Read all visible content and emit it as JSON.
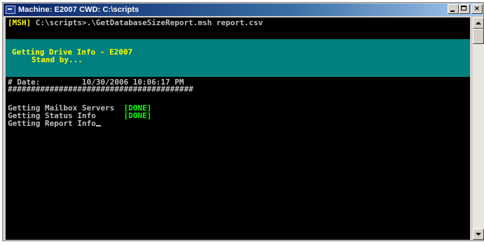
{
  "window": {
    "title": "Machine: E2007 CWD: C:\\scripts",
    "controls": {
      "minimize_label": "",
      "maximize_label": "",
      "close_label": "×"
    }
  },
  "console": {
    "prompt": {
      "tag": "[MSH]",
      "command": " C:\\scripts>.\\GetDatabaseSizeReport.msh report.csv"
    },
    "banner": {
      "line1": "Getting Drive Info - E2007",
      "line2": "Stand by..."
    },
    "date_line": "# Date:         10/30/2006 10:06:17 PM",
    "separator": "########################################",
    "tasks": [
      {
        "label": "Getting Mailbox Servers  ",
        "status": "[DONE]"
      },
      {
        "label": "Getting Status Info      ",
        "status": "[DONE]"
      },
      {
        "label": "Getting Report Info",
        "status": ""
      }
    ]
  },
  "colors": {
    "console_bg": "#000000",
    "console_text": "#c0c0c0",
    "prompt_tag": "#ffff00",
    "banner_bg": "#008080",
    "banner_text": "#ffff00",
    "done_status": "#00ff00"
  }
}
